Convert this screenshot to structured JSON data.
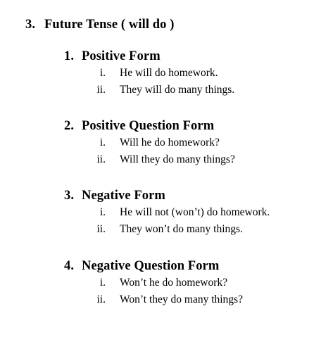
{
  "heading": {
    "number": "3.",
    "title": "Future Tense ( will do )"
  },
  "sections": [
    {
      "number": "1.",
      "title": "Positive Form",
      "items": [
        {
          "marker": "i.",
          "text": "He will do homework."
        },
        {
          "marker": "ii.",
          "text": "They will do many things."
        }
      ]
    },
    {
      "number": "2.",
      "title": "Positive Question Form",
      "items": [
        {
          "marker": "i.",
          "text": "Will he do homework?"
        },
        {
          "marker": "ii.",
          "text": "Will they do many things?"
        }
      ]
    },
    {
      "number": "3.",
      "title": "Negative Form",
      "items": [
        {
          "marker": "i.",
          "text": "He will not (won’t) do homework."
        },
        {
          "marker": "ii.",
          "text": "They won’t do many things."
        }
      ]
    },
    {
      "number": "4.",
      "title": "Negative Question Form",
      "items": [
        {
          "marker": "i.",
          "text": "Won’t he do homework?"
        },
        {
          "marker": "ii.",
          "text": "Won’t they do many things?"
        }
      ]
    }
  ]
}
